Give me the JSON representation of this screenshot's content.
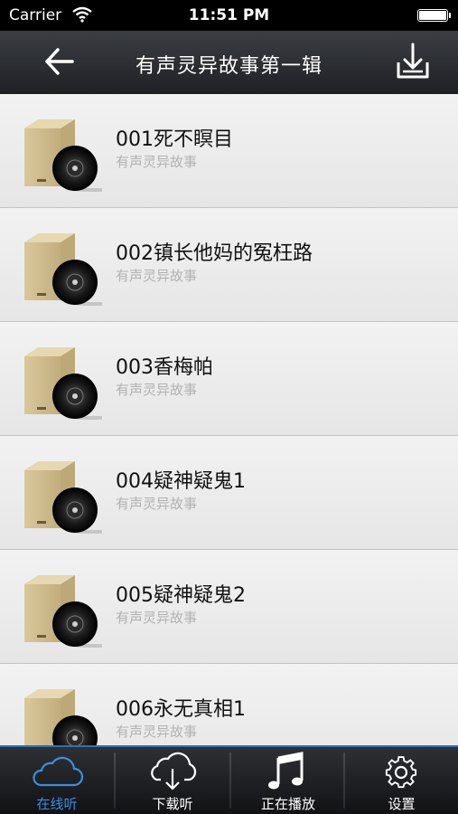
{
  "status_bar": {
    "carrier": "Carrier",
    "time": "11:51 PM"
  },
  "nav": {
    "title": "有声灵异故事第一辑"
  },
  "episodes": [
    {
      "title": "001死不瞑目",
      "subtitle": "有声灵异故事"
    },
    {
      "title": "002镇长他妈的冤枉路",
      "subtitle": "有声灵异故事"
    },
    {
      "title": "003香梅帕",
      "subtitle": "有声灵异故事"
    },
    {
      "title": "004疑神疑鬼1",
      "subtitle": "有声灵异故事"
    },
    {
      "title": "005疑神疑鬼2",
      "subtitle": "有声灵异故事"
    },
    {
      "title": "006永无真相1",
      "subtitle": "有声灵异故事"
    }
  ],
  "tabs": [
    {
      "label": "在线听",
      "icon": "cloud-icon",
      "active": true
    },
    {
      "label": "下载听",
      "icon": "cloud-download-icon",
      "active": false
    },
    {
      "label": "正在播放",
      "icon": "music-note-icon",
      "active": false
    },
    {
      "label": "设置",
      "icon": "gear-icon",
      "active": false
    }
  ],
  "colors": {
    "accent": "#3a8fe0",
    "nav_bg": "#2a2c30",
    "list_bg": "#ececec",
    "subtitle": "#b2b2b2"
  }
}
